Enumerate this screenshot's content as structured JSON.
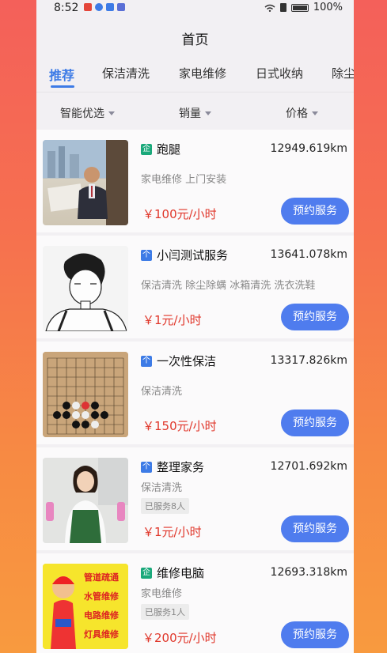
{
  "status_bar": {
    "time": "8:52",
    "battery": "100%"
  },
  "header": {
    "title": "首页"
  },
  "tabs": [
    {
      "label": "推荐"
    },
    {
      "label": "保洁清洗"
    },
    {
      "label": "家电维修"
    },
    {
      "label": "日式收纳"
    },
    {
      "label": "除尘"
    }
  ],
  "sort": [
    {
      "label": "智能优选"
    },
    {
      "label": "销量"
    },
    {
      "label": "价格"
    }
  ],
  "services": [
    {
      "badge": "企",
      "name": "跑腿",
      "distance": "12949.619km",
      "tags": "家电维修 上门安装",
      "served": "",
      "price": "￥100元/小时",
      "button": "预约服务",
      "image": "businessman-office-photo"
    },
    {
      "badge": "个",
      "name": "小闫测试服务",
      "distance": "13641.078km",
      "tags": "保洁清洗 除尘除螨 冰箱清洗 洗衣洗鞋",
      "served": "",
      "price": "￥1元/小时",
      "button": "预约服务",
      "image": "man-sketch-illustration"
    },
    {
      "badge": "个",
      "name": "一次性保洁",
      "distance": "13317.826km",
      "tags": "保洁清洗",
      "served": "",
      "price": "￥150元/小时",
      "button": "预约服务",
      "image": "go-board-photo"
    },
    {
      "badge": "个",
      "name": "整理家务",
      "distance": "12701.692km",
      "tags": "保洁清洗",
      "served": "已服务8人",
      "price": "￥1元/小时",
      "button": "预约服务",
      "image": "cleaning-woman-photo"
    },
    {
      "badge": "企",
      "name": "维修电脑",
      "distance": "12693.318km",
      "tags": "家电维修",
      "served": "已服务1人",
      "price": "￥200元/小时",
      "button": "预约服务",
      "image": "repair-poster"
    }
  ],
  "poster_text": [
    "管道疏通",
    "水管维修",
    "电路维修",
    "灯具维修"
  ],
  "colors": {
    "accent": "#3d7be6",
    "button": "#4f7cee",
    "price": "#e0362a",
    "company_badge": "#1aa87a"
  }
}
